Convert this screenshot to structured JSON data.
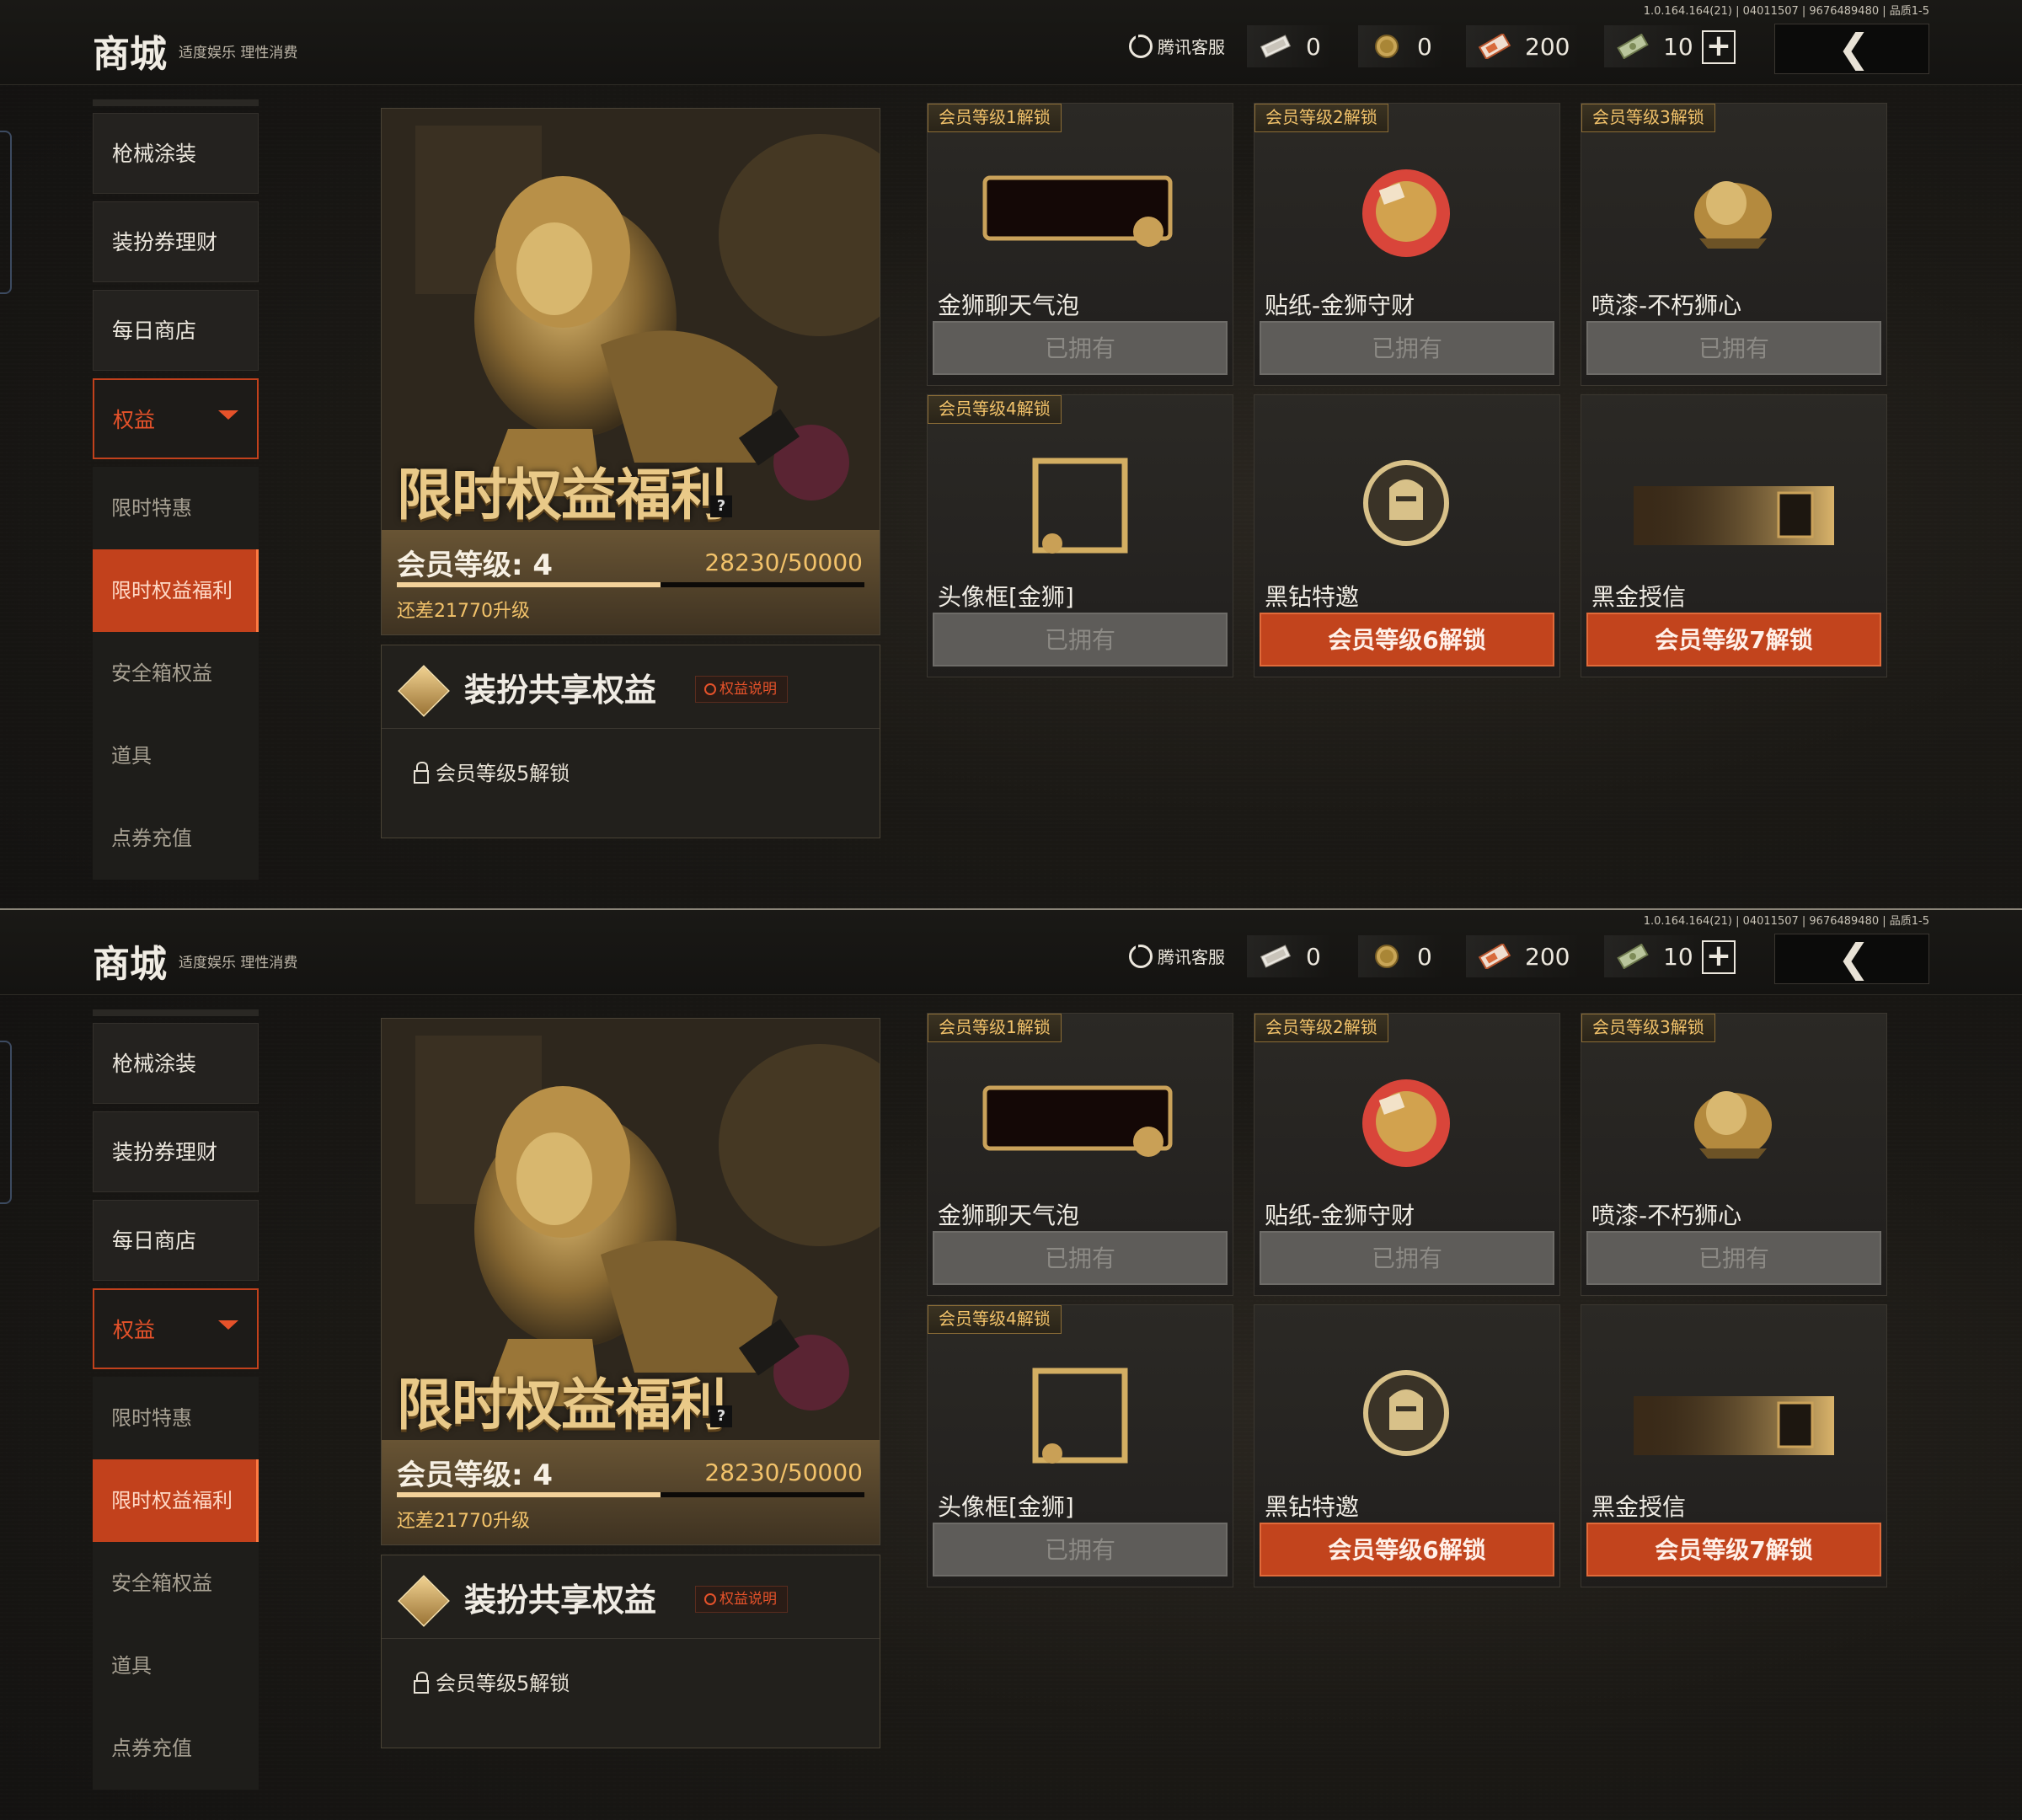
{
  "version": "1.0.164.164(21) | 04011507 | 9676489480 | 品质1-5",
  "header": {
    "title": "商城",
    "subtitle": "适度娱乐 理性消费",
    "service": "腾讯客服",
    "currencies": [
      {
        "icon": "ticket-icon",
        "value": "0"
      },
      {
        "icon": "gold-coin-icon",
        "value": "0"
      },
      {
        "icon": "voucher-icon",
        "value": "200"
      },
      {
        "icon": "cash-icon",
        "value": "10"
      }
    ],
    "add_label": "+",
    "back_label": "❮"
  },
  "sidebar": {
    "items": [
      {
        "label": "枪械涂装"
      },
      {
        "label": "装扮券理财"
      },
      {
        "label": "每日商店"
      }
    ],
    "parent": {
      "label": "权益"
    },
    "subitems": [
      {
        "label": "限时特惠",
        "active": false
      },
      {
        "label": "限时权益福利",
        "active": true
      },
      {
        "label": "安全箱权益",
        "active": false
      },
      {
        "label": "道具",
        "active": false
      },
      {
        "label": "点券充值",
        "active": false
      }
    ]
  },
  "hero": {
    "title": "限时权益福利",
    "help": "?",
    "level_label": "会员等级: 4",
    "progress_text": "28230/50000",
    "progress_fraction": 0.5646,
    "diff_text": "还差21770升级"
  },
  "share": {
    "title": "装扮共享权益",
    "explain": "权益说明",
    "lock_text": "会员等级5解锁"
  },
  "cards": [
    {
      "badge": "会员等级1解锁",
      "name": "金狮聊天气泡",
      "button": "已拥有",
      "owned": true,
      "icon": "chat-bubble-icon"
    },
    {
      "badge": "会员等级2解锁",
      "name": "贴纸-金狮守财",
      "button": "已拥有",
      "owned": true,
      "icon": "sticker-icon"
    },
    {
      "badge": "会员等级3解锁",
      "name": "喷漆-不朽狮心",
      "button": "已拥有",
      "owned": true,
      "icon": "spray-icon"
    },
    {
      "badge": "会员等级4解锁",
      "name": "头像框[金狮]",
      "button": "已拥有",
      "owned": true,
      "icon": "avatar-frame-icon"
    },
    {
      "badge": "",
      "name": "黑钻特邀",
      "button": "会员等级6解锁",
      "owned": false,
      "icon": "helmet-emblem-icon"
    },
    {
      "badge": "",
      "name": "黑金授信",
      "button": "会员等级7解锁",
      "owned": false,
      "icon": "card-banner-icon"
    }
  ]
}
